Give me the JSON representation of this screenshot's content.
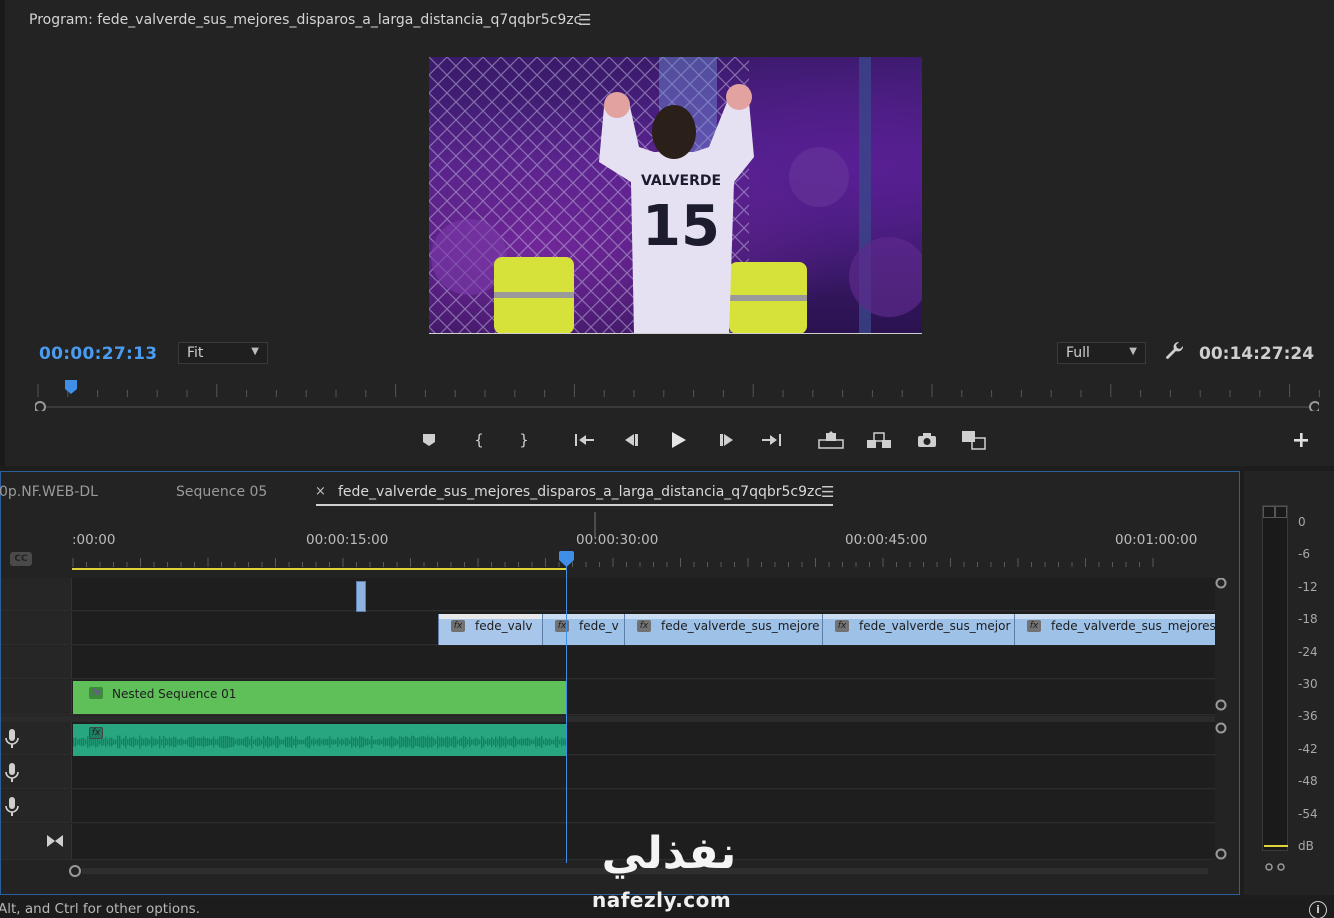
{
  "program_monitor": {
    "title": "Program: fede_valverde_sus_mejores_disparos_a_larga_distancia_q7qqbr5c9zc",
    "menu_icon": "hamburger-icon",
    "timecode_current": "00:00:27:13",
    "timecode_duration": "00:14:27:24",
    "zoom_value": "Fit",
    "quality_value": "Full",
    "video_overlay": {
      "jersey_name": "VALVERDE",
      "jersey_number": "15"
    },
    "transport_icons": [
      "marker-icon",
      "mark-in-icon",
      "mark-out-icon",
      "go-to-in-icon",
      "step-back-icon",
      "play-icon",
      "step-forward-icon",
      "go-to-out-icon",
      "lift-icon",
      "extract-icon",
      "export-frame-icon",
      "compare-icon",
      "add-button-icon"
    ]
  },
  "timeline": {
    "tabs": [
      {
        "label": "0p.NF.WEB-DL"
      },
      {
        "label": "Sequence 05"
      },
      {
        "label": "fede_valverde_sus_mejores_disparos_a_larga_distancia_q7qqbr5c9zc",
        "active": true
      }
    ],
    "tab_close_glyph": "×",
    "ruler_labels": [
      ":00:00",
      "00:00:15:00",
      "00:00:30:00",
      "00:00:45:00",
      "00:01:00:00"
    ],
    "cc_badge": "CC",
    "video_clips": [
      {
        "name": "fede_valv"
      },
      {
        "name": "fede_v"
      },
      {
        "name": "fede_valverde_sus_mejore"
      },
      {
        "name": "fede_valverde_sus_mejor"
      },
      {
        "name": "fede_valverde_sus_mejores"
      }
    ],
    "fx_label": "fx",
    "nested_clip": "Nested Sequence 01"
  },
  "audio_meter": {
    "labels": [
      "0",
      "-6",
      "-12",
      "-18",
      "-24",
      "-30",
      "-36",
      "-42",
      "-48",
      "-54",
      "dB"
    ]
  },
  "status_bar": {
    "text": "Alt, and Ctrl for other options.",
    "info_icon": "i"
  },
  "watermark": {
    "arabic": "نفذلي",
    "latin": "nafezly.com"
  },
  "colors": {
    "accent_blue": "#3f8ee8",
    "video_clip": "#9ec1e8",
    "nested_clip": "#5fbf58",
    "audio_clip": "#27a680",
    "work_area": "#e2d23a"
  }
}
